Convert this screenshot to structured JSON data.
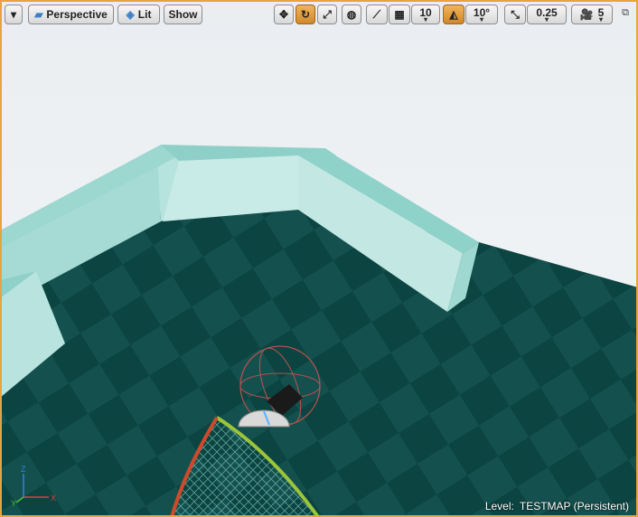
{
  "toolbar": {
    "view_mode": "Perspective",
    "lit": "Lit",
    "show": "Show",
    "grid_snap_value": "10",
    "rotation_snap_value": "10°",
    "scale_snap_value": "0.25",
    "camera_speed": "5"
  },
  "status": {
    "level_label": "Level:",
    "level_name": "TESTMAP (Persistent)"
  },
  "colors": {
    "accent": "#e8a33c",
    "floor_dark": "#0c4d4a",
    "floor_light": "#165c58",
    "wall": "#a7dcd6"
  },
  "icons": [
    "dropdown-icon",
    "perspective-icon",
    "lit-icon",
    "translate-icon",
    "rotate-icon",
    "scale-icon",
    "world-local-icon",
    "surface-snap-icon",
    "grid-icon",
    "rotation-snap-icon",
    "scale-snap-icon",
    "camera-speed-icon",
    "maximize-icon"
  ]
}
